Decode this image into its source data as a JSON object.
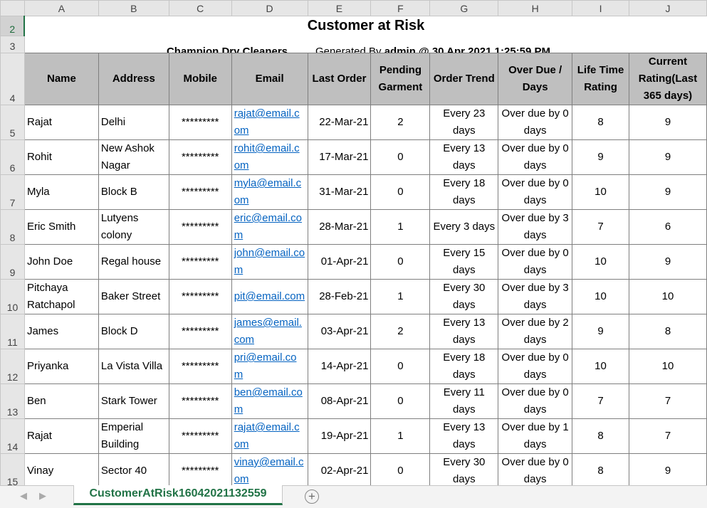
{
  "columns": [
    "A",
    "B",
    "C",
    "D",
    "E",
    "F",
    "G",
    "H",
    "I",
    "J"
  ],
  "row_numbers": [
    "2",
    "3",
    "4",
    "5",
    "6",
    "7",
    "8",
    "9",
    "10",
    "11",
    "12",
    "13",
    "14",
    "15"
  ],
  "report": {
    "title": "Customer at Risk",
    "company": "Champion Dry Cleaners",
    "generated_prefix": "Generated By",
    "generated_user": "admin @ 30 Apr 2021 1:25:59 PM"
  },
  "headers": [
    "Name",
    "Address",
    "Mobile",
    "Email",
    "Last Order",
    "Pending Garment",
    "Order Trend",
    "Over Due / Days",
    "Life Time Rating",
    "Current Rating(Last 365 days)"
  ],
  "rows": [
    {
      "name": "Rajat",
      "address": "Delhi",
      "mobile": "*********",
      "email": "rajat@email.com",
      "last_order": "22-Mar-21",
      "pending": "2",
      "trend": "Every 23 days",
      "overdue": "Over due by 0 days",
      "lifetime": "8",
      "current": "9"
    },
    {
      "name": "Rohit",
      "address": "New Ashok Nagar",
      "mobile": "*********",
      "email": "rohit@email.com",
      "last_order": "17-Mar-21",
      "pending": "0",
      "trend": "Every 13 days",
      "overdue": "Over due by 0 days",
      "lifetime": "9",
      "current": "9"
    },
    {
      "name": "Myla",
      "address": "Block B",
      "mobile": "*********",
      "email": "myla@email.com",
      "last_order": "31-Mar-21",
      "pending": "0",
      "trend": "Every 18 days",
      "overdue": "Over due by 0 days",
      "lifetime": "10",
      "current": "9"
    },
    {
      "name": "Eric Smith",
      "address": "Lutyens colony",
      "mobile": "*********",
      "email": "eric@email.com",
      "last_order": "28-Mar-21",
      "pending": "1",
      "trend": "Every 3 days",
      "overdue": "Over due by 3 days",
      "lifetime": "7",
      "current": "6"
    },
    {
      "name": "John Doe",
      "address": "Regal house",
      "mobile": "*********",
      "email": "john@email.com",
      "last_order": "01-Apr-21",
      "pending": "0",
      "trend": "Every 15 days",
      "overdue": "Over due by 0 days",
      "lifetime": "10",
      "current": "9"
    },
    {
      "name": "Pitchaya Ratchapol",
      "address": "Baker Street",
      "mobile": "*********",
      "email": "pit@email.com",
      "last_order": "28-Feb-21",
      "pending": "1",
      "trend": "Every 30 days",
      "overdue": "Over due by 3 days",
      "lifetime": "10",
      "current": "10"
    },
    {
      "name": "James",
      "address": "Block D",
      "mobile": "*********",
      "email": "james@email.com",
      "last_order": "03-Apr-21",
      "pending": "2",
      "trend": "Every 13 days",
      "overdue": "Over due by 2 days",
      "lifetime": "9",
      "current": "8"
    },
    {
      "name": "Priyanka",
      "address": "La Vista Villa",
      "mobile": "*********",
      "email": "pri@email.com",
      "last_order": "14-Apr-21",
      "pending": "0",
      "trend": "Every 18 days",
      "overdue": "Over due by 0 days",
      "lifetime": "10",
      "current": "10"
    },
    {
      "name": "Ben",
      "address": "Stark Tower",
      "mobile": "*********",
      "email": "ben@email.com",
      "last_order": "08-Apr-21",
      "pending": "0",
      "trend": "Every 11 days",
      "overdue": "Over due by 0 days",
      "lifetime": "7",
      "current": "7"
    },
    {
      "name": "Rajat",
      "address": "Emperial Building",
      "mobile": "*********",
      "email": "rajat@email.com",
      "last_order": "19-Apr-21",
      "pending": "1",
      "trend": "Every 13 days",
      "overdue": "Over due by 1 days",
      "lifetime": "8",
      "current": "7"
    },
    {
      "name": "Vinay",
      "address": "Sector 40",
      "mobile": "*********",
      "email": "vinay@email.com",
      "last_order": "02-Apr-21",
      "pending": "0",
      "trend": "Every 30 days",
      "overdue": "Over due by 0 days",
      "lifetime": "8",
      "current": "9"
    }
  ],
  "sheet_tab": "CustomerAtRisk16042021132559",
  "icons": {
    "prev": "chevron-left-icon",
    "next": "chevron-right-icon",
    "add": "plus-circle-icon"
  },
  "colors": {
    "header_fill": "#bfbfbf",
    "link": "#0563c1",
    "accent": "#217346"
  }
}
